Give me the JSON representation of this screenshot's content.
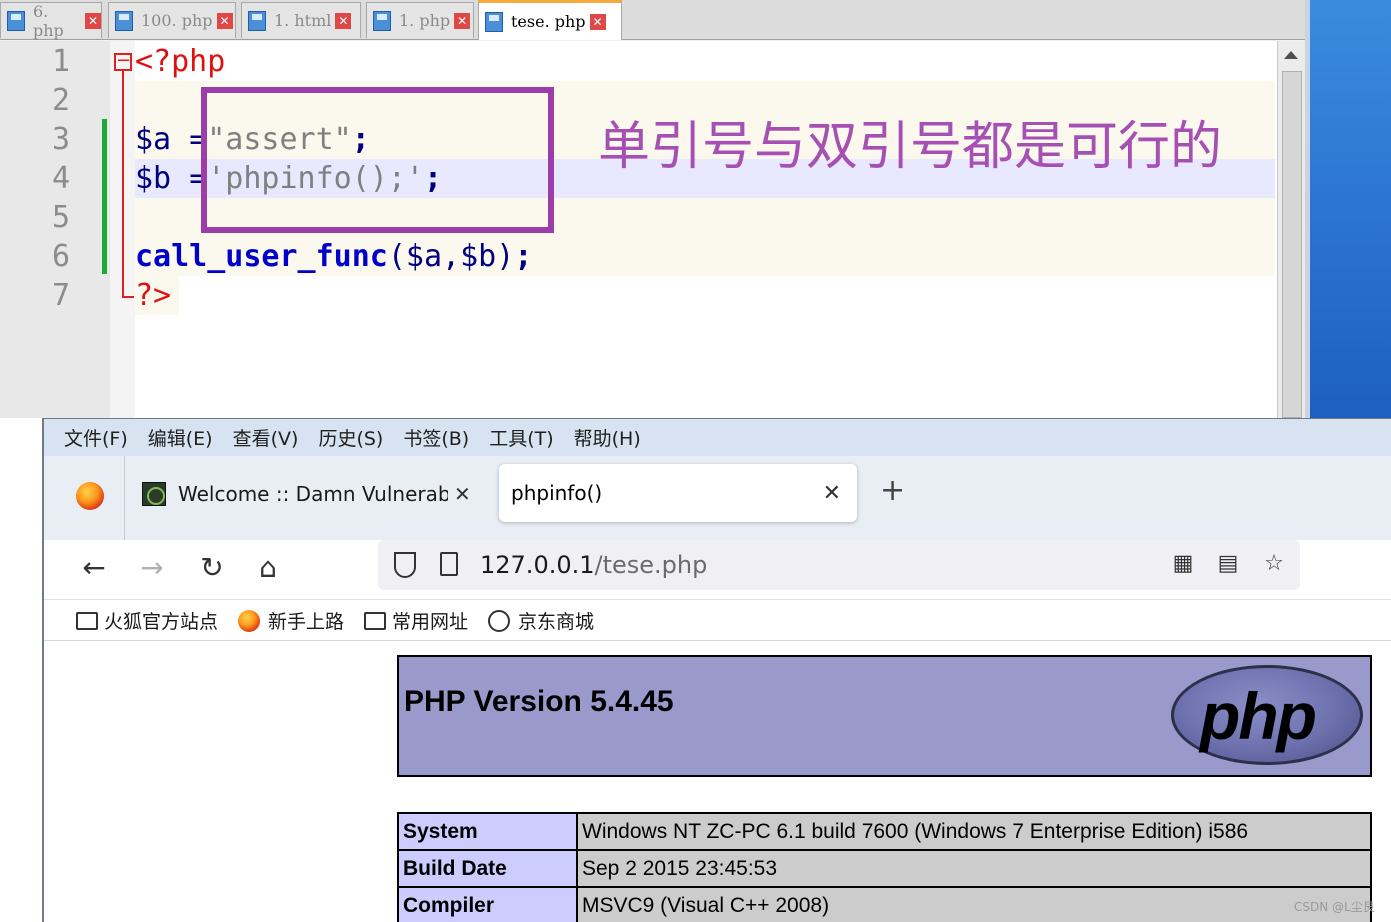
{
  "editor": {
    "tabs": [
      {
        "label": "6. php"
      },
      {
        "label": "100. php"
      },
      {
        "label": "1. html"
      },
      {
        "label": "1. php"
      },
      {
        "label": "tese. php"
      }
    ],
    "line_numbers": [
      "1",
      "2",
      "3",
      "4",
      "5",
      "6",
      "7"
    ],
    "code": {
      "l1_open": "<?php",
      "l3_var": "$a ",
      "l3_op": "=",
      "l3_str": "\"assert\"",
      "l3_semi": ";",
      "l4_var": "$b ",
      "l4_op": "=",
      "l4_str": "'phpinfo();'",
      "l4_semi": ";",
      "l6_fn": "call_user_func",
      "l6_args": "($a,$b)",
      "l6_semi": ";",
      "l7_close": "?>"
    },
    "annotation": "单引号与双引号都是可行的"
  },
  "browser": {
    "menu": [
      "文件(F)",
      "编辑(E)",
      "查看(V)",
      "历史(S)",
      "书签(B)",
      "工具(T)",
      "帮助(H)"
    ],
    "tabs": {
      "inactive_title": "Welcome :: Damn Vulnerable",
      "active_title": "phpinfo()",
      "close_glyph": "✕",
      "new_tab_glyph": "+"
    },
    "nav": {
      "back": "←",
      "forward": "→",
      "reload": "↻",
      "home": "⌂"
    },
    "url": {
      "host": "127.0.0.1",
      "path": "/tese.php"
    },
    "bookmarks": [
      {
        "label": "火狐官方站点",
        "icon": "folder-icon"
      },
      {
        "label": "新手上路",
        "icon": "firefox-icon"
      },
      {
        "label": "常用网址",
        "icon": "folder-icon"
      },
      {
        "label": "京东商城",
        "icon": "globe-icon"
      }
    ]
  },
  "phpinfo": {
    "version_title": "PHP Version 5.4.45",
    "logo_text": "php",
    "rows": [
      {
        "key": "System",
        "value": "Windows NT ZC-PC 6.1 build 7600 (Windows 7 Enterprise Edition) i586"
      },
      {
        "key": "Build Date",
        "value": "Sep 2 2015 23:45:53"
      },
      {
        "key": "Compiler",
        "value": "MSVC9 (Visual C++ 2008)"
      }
    ]
  },
  "watermark": "CSDN @L尘艮",
  "colors": {
    "annotation": "#a650b4",
    "php_header_bg": "#9999cc",
    "php_key_bg": "#ccccff",
    "php_value_bg": "#cccccc"
  }
}
